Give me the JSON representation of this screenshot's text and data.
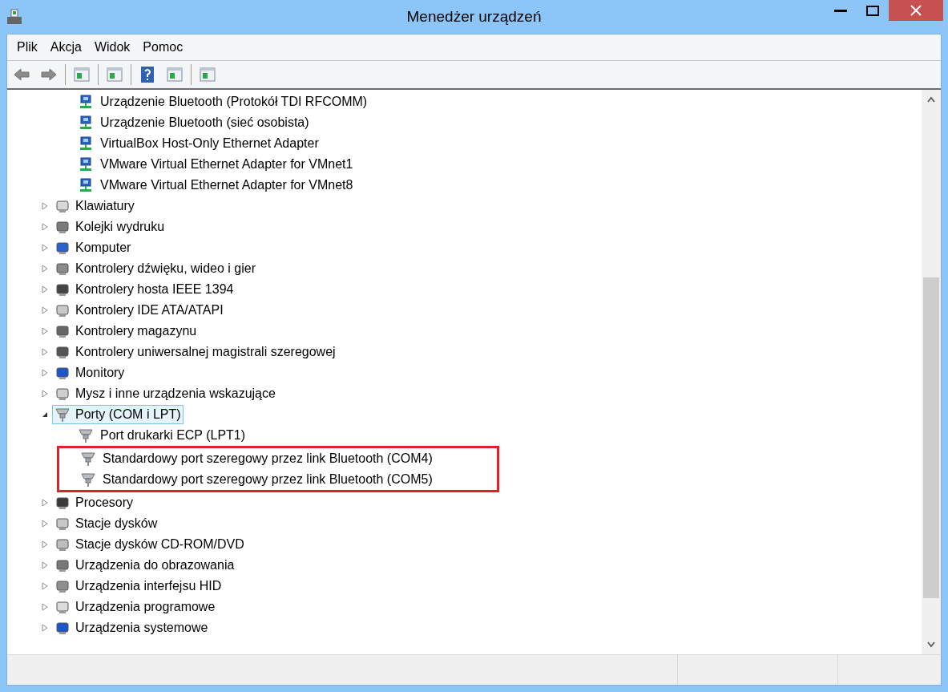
{
  "window": {
    "title": "Menedżer urządzeń"
  },
  "menu": [
    "Plik",
    "Akcja",
    "Widok",
    "Pomoc"
  ],
  "tree": {
    "continued_children": [
      {
        "label": "Urządzenie Bluetooth (Protokół TDI RFCOMM)"
      },
      {
        "label": "Urządzenie Bluetooth (sieć osobista)"
      },
      {
        "label": "VirtualBox Host-Only Ethernet Adapter"
      },
      {
        "label": "VMware Virtual Ethernet Adapter for VMnet1"
      },
      {
        "label": "VMware Virtual Ethernet Adapter for VMnet8"
      }
    ],
    "items": [
      {
        "label": "Klawiatury",
        "expanded": false,
        "selected": false
      },
      {
        "label": "Kolejki wydruku",
        "expanded": false,
        "selected": false
      },
      {
        "label": "Komputer",
        "expanded": false,
        "selected": false
      },
      {
        "label": "Kontrolery dźwięku, wideo i gier",
        "expanded": false,
        "selected": false
      },
      {
        "label": "Kontrolery hosta IEEE 1394",
        "expanded": false,
        "selected": false
      },
      {
        "label": "Kontrolery IDE ATA/ATAPI",
        "expanded": false,
        "selected": false
      },
      {
        "label": "Kontrolery magazynu",
        "expanded": false,
        "selected": false
      },
      {
        "label": "Kontrolery uniwersalnej magistrali szeregowej",
        "expanded": false,
        "selected": false
      },
      {
        "label": "Monitory",
        "expanded": false,
        "selected": false
      },
      {
        "label": "Mysz i inne urządzenia wskazujące",
        "expanded": false,
        "selected": false
      },
      {
        "label": "Porty (COM i LPT)",
        "expanded": true,
        "selected": true,
        "children": [
          {
            "label": "Port drukarki ECP (LPT1)",
            "highlighted": false
          },
          {
            "label": "Standardowy port szeregowy przez link Bluetooth (COM4)",
            "highlighted": true
          },
          {
            "label": "Standardowy port szeregowy przez link Bluetooth (COM5)",
            "highlighted": true
          }
        ]
      },
      {
        "label": "Procesory",
        "expanded": false,
        "selected": false
      },
      {
        "label": "Stacje dysków",
        "expanded": false,
        "selected": false
      },
      {
        "label": "Stacje dysków CD-ROM/DVD",
        "expanded": false,
        "selected": false
      },
      {
        "label": "Urządzenia do obrazowania",
        "expanded": false,
        "selected": false
      },
      {
        "label": "Urządzenia interfejsu HID",
        "expanded": false,
        "selected": false
      },
      {
        "label": "Urządzenia programowe",
        "expanded": false,
        "selected": false
      },
      {
        "label": "Urządzenia systemowe",
        "expanded": false,
        "selected": false
      }
    ]
  }
}
